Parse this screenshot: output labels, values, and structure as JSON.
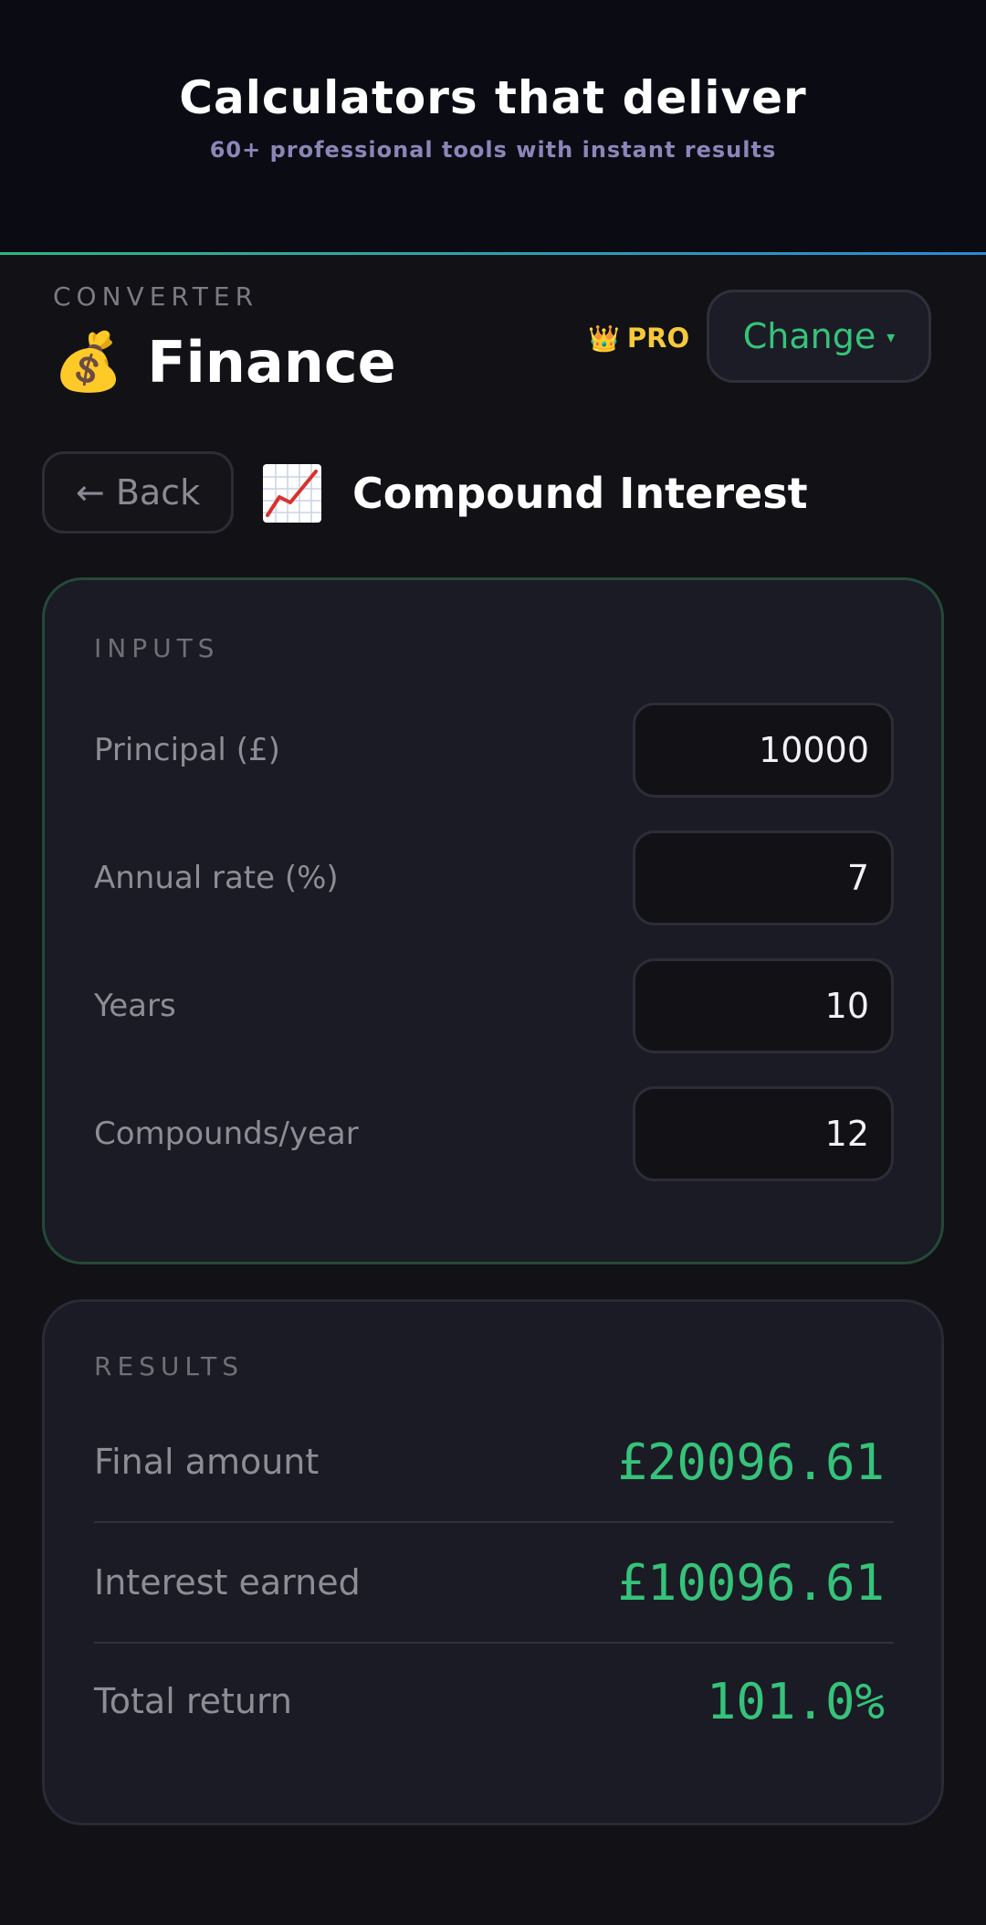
{
  "hero": {
    "title": "Calculators that deliver",
    "subtitle": "60+ professional tools with instant results"
  },
  "category": {
    "eyebrow": "CONVERTER",
    "icon": "💰",
    "icon_name": "money-bag-icon",
    "name": "Finance",
    "pro_icon": "👑",
    "pro_label": "PRO",
    "change_label": "Change",
    "change_caret": "▾"
  },
  "calculator": {
    "back_label": "← Back",
    "icon_name": "chart-increasing-icon",
    "title": "Compound Interest"
  },
  "inputs": {
    "heading": "INPUTS",
    "fields": [
      {
        "label": "Principal (£)",
        "value": "10000"
      },
      {
        "label": "Annual rate (%)",
        "value": "7"
      },
      {
        "label": "Years",
        "value": "10"
      },
      {
        "label": "Compounds/year",
        "value": "12"
      }
    ]
  },
  "results": {
    "heading": "RESULTS",
    "rows": [
      {
        "label": "Final amount",
        "value": "£20096.61"
      },
      {
        "label": "Interest earned",
        "value": "£10096.61"
      },
      {
        "label": "Total return",
        "value": "101.0%"
      }
    ]
  },
  "colors": {
    "accent_green": "#35c37a",
    "pro_gold": "#f5c93a",
    "subtitle_purple": "#8b86b8",
    "background": "#111116",
    "card": "#1b1b25"
  }
}
